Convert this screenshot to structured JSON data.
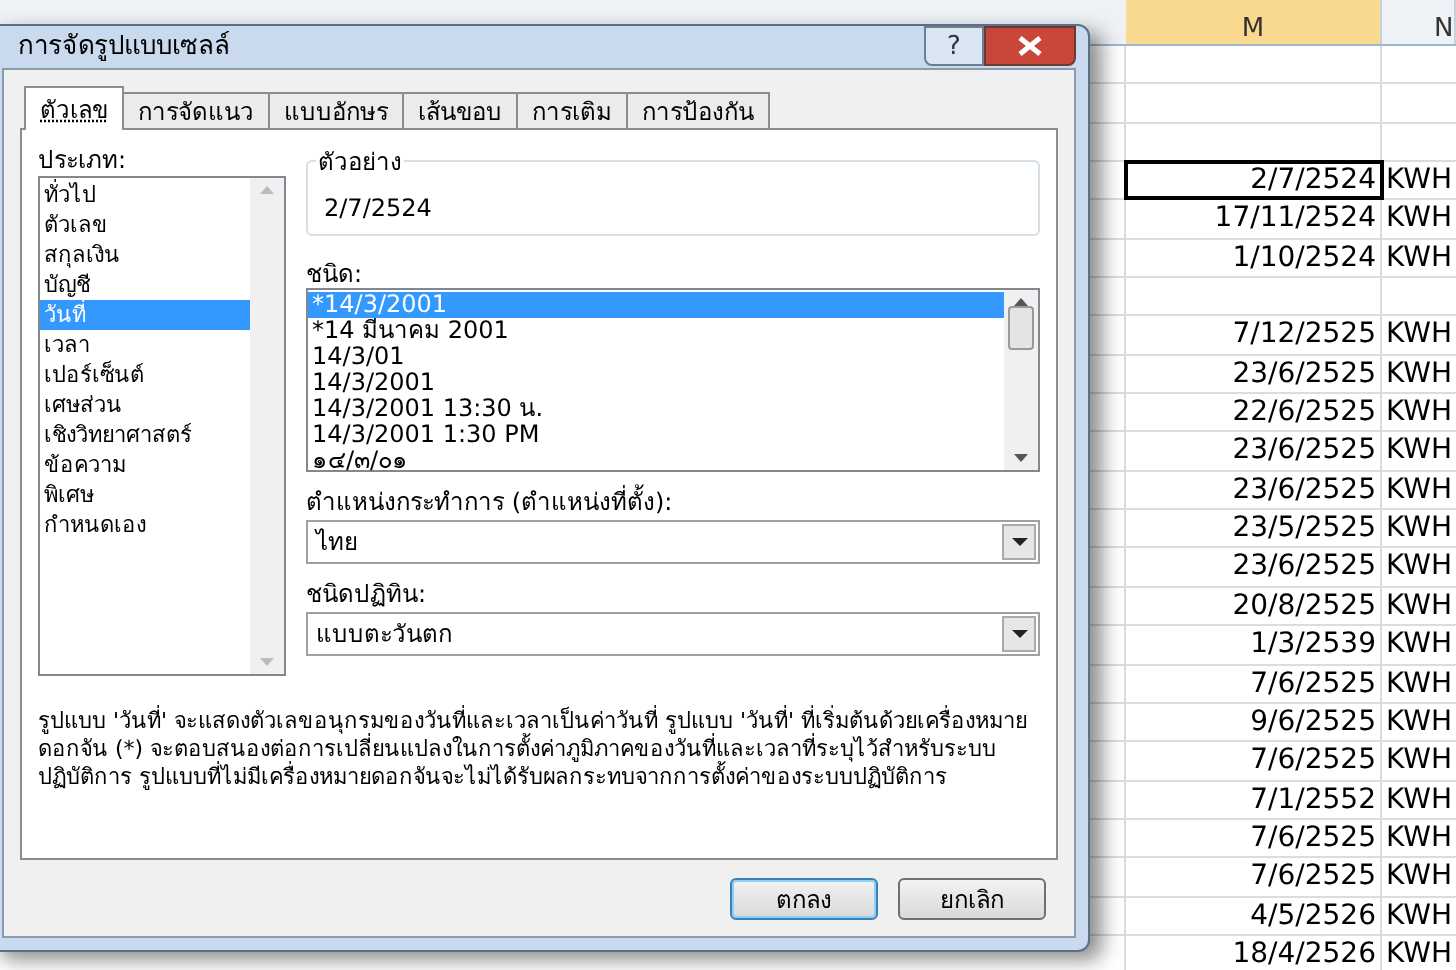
{
  "sheet": {
    "columns": [
      {
        "label": "M",
        "selected": true
      },
      {
        "label": "N",
        "selected": false
      }
    ],
    "rows": [
      {
        "column_m": "",
        "column_n": "",
        "selected": false
      },
      {
        "column_m": "",
        "column_n": "",
        "selected": false
      },
      {
        "column_m": "",
        "column_n": "",
        "selected": false
      },
      {
        "column_m": "2/7/2524",
        "column_n": "KWH",
        "selected": true
      },
      {
        "column_m": "17/11/2524",
        "column_n": "KWH",
        "selected": false
      },
      {
        "column_m": "1/10/2524",
        "column_n": "KWH",
        "selected": false
      },
      {
        "column_m": "",
        "column_n": "",
        "selected": false
      },
      {
        "column_m": "7/12/2525",
        "column_n": "KWH",
        "selected": false
      },
      {
        "column_m": "23/6/2525",
        "column_n": "KWH",
        "selected": false
      },
      {
        "column_m": "22/6/2525",
        "column_n": "KWH",
        "selected": false
      },
      {
        "column_m": "23/6/2525",
        "column_n": "KWH",
        "selected": false
      },
      {
        "column_m": "23/6/2525",
        "column_n": "KWH",
        "selected": false
      },
      {
        "column_m": "23/5/2525",
        "column_n": "KWH",
        "selected": false
      },
      {
        "column_m": "23/6/2525",
        "column_n": "KWH",
        "selected": false
      },
      {
        "column_m": "20/8/2525",
        "column_n": "KWH",
        "selected": false
      },
      {
        "column_m": "1/3/2539",
        "column_n": "KWH",
        "selected": false
      },
      {
        "column_m": "7/6/2525",
        "column_n": "KWH",
        "selected": false
      },
      {
        "column_m": "9/6/2525",
        "column_n": "KWH",
        "selected": false
      },
      {
        "column_m": "7/6/2525",
        "column_n": "KWH",
        "selected": false
      },
      {
        "column_m": "7/1/2552",
        "column_n": "KWH",
        "selected": false
      },
      {
        "column_m": "7/6/2525",
        "column_n": "KWH",
        "selected": false
      },
      {
        "column_m": "7/6/2525",
        "column_n": "KWH",
        "selected": false
      },
      {
        "column_m": "4/5/2526",
        "column_n": "KWH",
        "selected": false
      },
      {
        "column_m": "18/4/2526",
        "column_n": "KWH",
        "selected": false
      }
    ]
  },
  "dialog": {
    "title": "การจัดรูปแบบเซลล์",
    "help": "?",
    "tabs": [
      {
        "label": "ตัวเลข",
        "selected": true
      },
      {
        "label": "การจัดแนว",
        "selected": false
      },
      {
        "label": "แบบอักษร",
        "selected": false
      },
      {
        "label": "เส้นขอบ",
        "selected": false
      },
      {
        "label": "การเติม",
        "selected": false
      },
      {
        "label": "การป้องกัน",
        "selected": false
      }
    ],
    "category_label": "ประเภท:",
    "categories": [
      {
        "label": "ทั่วไป",
        "selected": false
      },
      {
        "label": "ตัวเลข",
        "selected": false
      },
      {
        "label": "สกุลเงิน",
        "selected": false
      },
      {
        "label": "บัญชี",
        "selected": false
      },
      {
        "label": "วันที่",
        "selected": true
      },
      {
        "label": "เวลา",
        "selected": false
      },
      {
        "label": "เปอร์เซ็นต์",
        "selected": false
      },
      {
        "label": "เศษส่วน",
        "selected": false
      },
      {
        "label": "เชิงวิทยาศาสตร์",
        "selected": false
      },
      {
        "label": "ข้อความ",
        "selected": false
      },
      {
        "label": "พิเศษ",
        "selected": false
      },
      {
        "label": "กำหนดเอง",
        "selected": false
      }
    ],
    "sample": {
      "label": "ตัวอย่าง",
      "value": "2/7/2524"
    },
    "type_label": "ชนิด:",
    "types": [
      {
        "label": "*14/3/2001",
        "selected": true
      },
      {
        "label": "*14 มีนาคม 2001",
        "selected": false
      },
      {
        "label": "14/3/01",
        "selected": false
      },
      {
        "label": "14/3/2001",
        "selected": false
      },
      {
        "label": "14/3/2001 13:30 น.",
        "selected": false
      },
      {
        "label": "14/3/2001 1:30 PM",
        "selected": false
      },
      {
        "label": "๑๔/๓/๐๑",
        "selected": false
      }
    ],
    "locale": {
      "label": "ตำแหน่งกระทำการ (ตำแหน่งที่ตั้ง):",
      "value": "ไทย"
    },
    "calendar": {
      "label": "ชนิดปฏิทิน:",
      "value": "แบบตะวันตก"
    },
    "description": "รูปแบบ 'วันที่' จะแสดงตัวเลขอนุกรมของวันที่และเวลาเป็นค่าวันที่ รูปแบบ 'วันที่' ที่เริ่มต้นด้วยเครื่องหมายดอกจัน (*) จะตอบสนองต่อการเปลี่ยนแปลงในการตั้งค่าภูมิภาคของวันที่และเวลาที่ระบุไว้สำหรับระบบปฏิบัติการ รูปแบบที่ไม่มีเครื่องหมายดอกจันจะไม่ได้รับผลกระทบจากการตั้งค่าของระบบปฏิบัติการ",
    "buttons": [
      {
        "label": "ตกลง",
        "kind": "default"
      },
      {
        "label": "ยกเลิก",
        "kind": "normal"
      }
    ]
  }
}
